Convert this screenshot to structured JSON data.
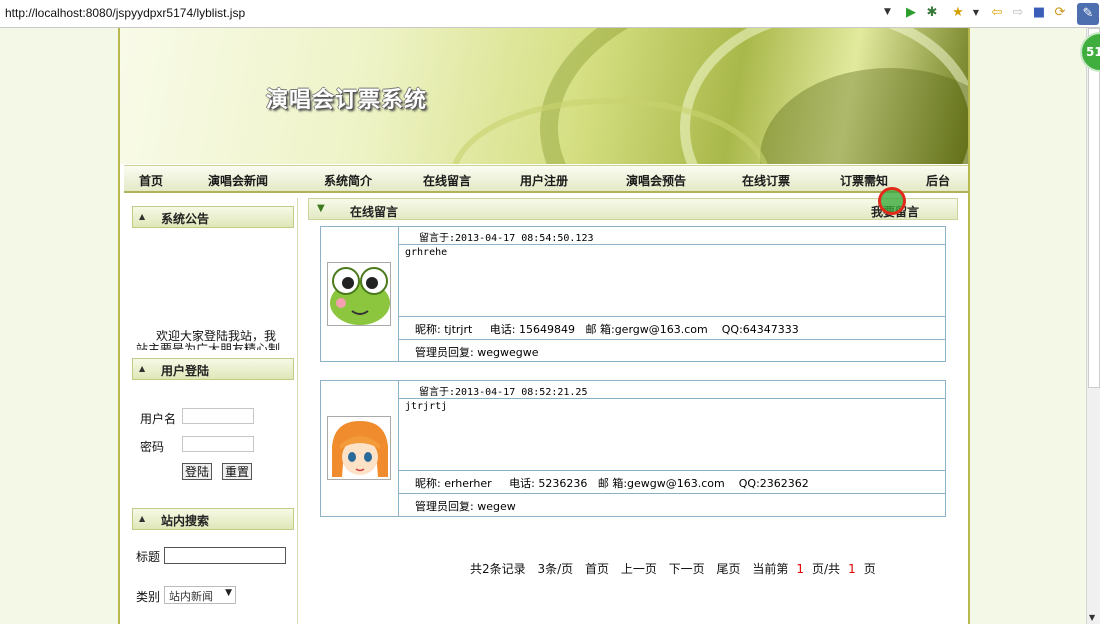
{
  "browser": {
    "url": "http://localhost:8080/jspyydpxr5174/lyblist.jsp",
    "badge": "51"
  },
  "site": {
    "title": "演唱会订票系统"
  },
  "nav": {
    "items": [
      "首页",
      "演唱会新闻",
      "系统简介",
      "在线留言",
      "用户注册",
      "演唱会预告",
      "在线订票",
      "订票需知",
      "后台"
    ]
  },
  "sidebar": {
    "notice": {
      "title": "系统公告",
      "text": "欢迎大家登陆我站，我站主要是为广大朋友精心制作的"
    },
    "login": {
      "title": "用户登陆",
      "username_label": "用户名",
      "password_label": "密码",
      "login_button": "登陆",
      "reset_button": "重置"
    },
    "search": {
      "title": "站内搜索",
      "title_label": "标题",
      "category_label": "类别",
      "category_value": "站内新闻"
    }
  },
  "main": {
    "title": "在线留言",
    "action": "我要留言",
    "messages": [
      {
        "time": "留言于:2013-04-17 08:54:50.123",
        "content": "grhrehe",
        "nickname": "昵称: tjtrjrt",
        "phone": "电话: 15649849",
        "email": "邮 箱:gergw@163.com",
        "qq": "QQ:64347333",
        "reply": "管理员回复: wegwegwe",
        "avatar": "frog-avatar"
      },
      {
        "time": "留言于:2013-04-17 08:52:21.25",
        "content": "jtrjrtj",
        "nickname": "昵称: erherher",
        "phone": "电话: 5236236",
        "email": "邮 箱:gewgw@163.com",
        "qq": "QQ:2362362",
        "reply": "管理员回复: wegew",
        "avatar": "anime-girl-avatar"
      }
    ],
    "pager": {
      "total": "共2条记录",
      "per_page": "3条/页",
      "first": "首页",
      "prev": "上一页",
      "next": "下一页",
      "last": "尾页",
      "current_prefix": "当前第",
      "current_page": "1",
      "current_mid": "页/共",
      "total_pages": "1",
      "current_suffix": "页"
    }
  }
}
